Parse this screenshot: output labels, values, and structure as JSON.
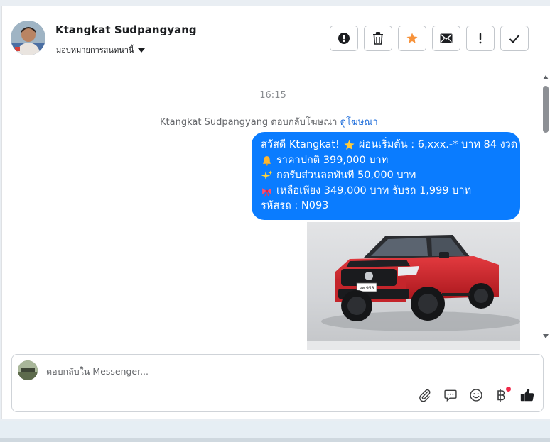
{
  "header": {
    "contact_name": "Ktangkat Sudpangyang",
    "assign_label": "มอบหมายการสนทนานี้"
  },
  "toolbar": {
    "buttons": [
      {
        "icon": "alert-circle-icon"
      },
      {
        "icon": "trash-icon"
      },
      {
        "icon": "star-icon",
        "color": "#f7923a"
      },
      {
        "icon": "mail-icon"
      },
      {
        "icon": "exclamation-icon"
      },
      {
        "icon": "check-icon"
      }
    ]
  },
  "conversation": {
    "timestamp": "16:15",
    "reply_note": {
      "text": "Ktangkat Sudpangyang ตอบกลับโฆษณา",
      "link": "ดูโฆษณา"
    },
    "message": {
      "lines": [
        {
          "emoji": "star-emoji",
          "pre": "สวัสดี Ktangkat!",
          "text": "ผ่อนเริ่มต้น : 6,xxx.-* บาท 84 งวด"
        },
        {
          "emoji": "bell-emoji",
          "text": "ราคาปกติ  399,000 บาท"
        },
        {
          "emoji": "sparkles-emoji",
          "text": "กดรับส่วนลดทันที 50,000 บาท"
        },
        {
          "emoji": "ribbon-emoji",
          "text": "เหลือเพียง 349,000 บาท รับรถ 1,999 บาท"
        },
        {
          "emoji": "",
          "text": "รหัสรถ : N093"
        }
      ],
      "bubble_color": "#0a7cff"
    },
    "attachment": {
      "type": "image",
      "subject": "red pickup truck",
      "plate": "ผท 958"
    }
  },
  "composer": {
    "placeholder": "ตอบกลับใน Messenger...",
    "tools": [
      "paperclip-icon",
      "chat-bubble-icon",
      "smiley-icon",
      "baht-icon",
      "thumbs-up-icon"
    ]
  }
}
